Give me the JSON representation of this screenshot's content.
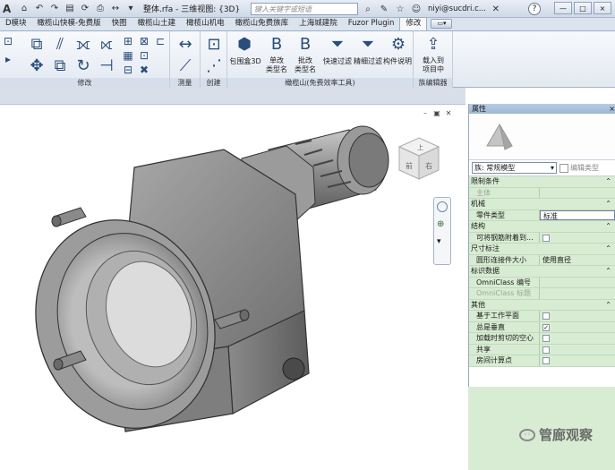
{
  "titlebar": {
    "logo": "A",
    "doc_title": "整体.rfa - 三维视图: {3D}",
    "search_placeholder": "键入关键字或短语",
    "user": "niyi@sucdri.c...",
    "help": "?",
    "win_min": "—",
    "win_max": "□",
    "win_close": "×"
  },
  "tabs": [
    {
      "label": "D模块"
    },
    {
      "label": "橄榄山快模-免费版"
    },
    {
      "label": "快图"
    },
    {
      "label": "橄榄山土建"
    },
    {
      "label": "橄榄山机电"
    },
    {
      "label": "橄榄山免费族库"
    },
    {
      "label": "上海城建院"
    },
    {
      "label": "Fuzor Plugin"
    },
    {
      "label": "修改",
      "active": true
    }
  ],
  "ribbon": {
    "panels": [
      {
        "label": "修改"
      },
      {
        "label": "测量"
      },
      {
        "label": "创建"
      },
      {
        "label": "橄榄山(免费效率工具)"
      },
      {
        "label": "族编辑器"
      }
    ],
    "buttons": {
      "bbox3d": "包围盒3D",
      "single_type": "单改\n类型名",
      "batch_type": "批改\n类型名",
      "quick_filter": "快速过滤",
      "fine_filter": "精细过滤",
      "component_desc": "构件说明",
      "load_project_1": "载入到",
      "load_project_2": "项目中",
      "single_change": "单改",
      "type_name": "类型名",
      "batch_change": "批改",
      "type_name2": "类型名"
    }
  },
  "viewcube": {
    "top": "上",
    "front": "前",
    "right": "右"
  },
  "properties": {
    "title": "属性",
    "close": "×",
    "type_selector": "族: 常规模型",
    "edit_type": "编辑类型",
    "groups": [
      {
        "name": "限制条件",
        "rows": [
          {
            "k": "主体",
            "v": "",
            "dim": true
          }
        ]
      },
      {
        "name": "机械",
        "rows": [
          {
            "k": "零件类型",
            "v": "标准",
            "field": true
          }
        ]
      },
      {
        "name": "结构",
        "rows": [
          {
            "k": "可将钢筋附着到...",
            "v": "",
            "check": ""
          }
        ]
      },
      {
        "name": "尺寸标注",
        "rows": [
          {
            "k": "圆形连接件大小",
            "v": "使用直径"
          }
        ]
      },
      {
        "name": "标识数据",
        "rows": [
          {
            "k": "OmniClass 编号",
            "v": ""
          },
          {
            "k": "OmniClass 标题",
            "v": "",
            "dim": true
          }
        ]
      },
      {
        "name": "其他",
        "rows": [
          {
            "k": "基于工作平面",
            "v": "",
            "check": ""
          },
          {
            "k": "总是垂直",
            "v": "",
            "check": "✓"
          },
          {
            "k": "加载时剪切的空心",
            "v": "",
            "check": ""
          },
          {
            "k": "共享",
            "v": "",
            "check": ""
          },
          {
            "k": "房间计算点",
            "v": "",
            "check": ""
          }
        ]
      }
    ]
  },
  "watermark": {
    "text": "管廊观察"
  },
  "colors": {
    "accent": "#2a4d7a",
    "props_bg": "#d8ecd3",
    "tab_bg": "#dbe3ee"
  }
}
